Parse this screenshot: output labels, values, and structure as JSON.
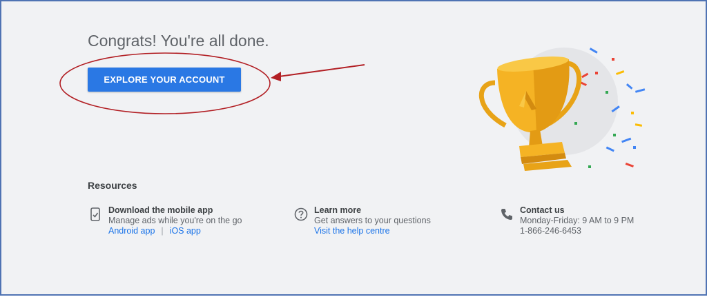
{
  "main": {
    "title": "Congrats! You're all done.",
    "explore_button_label": "EXPLORE YOUR ACCOUNT"
  },
  "resources": {
    "heading": "Resources",
    "items": [
      {
        "icon": "phone-checklist-icon",
        "title": "Download the mobile app",
        "description": "Manage ads while you're on the go",
        "links": [
          "Android app",
          "iOS app"
        ],
        "separator": "|"
      },
      {
        "icon": "help-circle-icon",
        "title": "Learn more",
        "description": "Get answers to your questions",
        "links": [
          "Visit the help centre"
        ]
      },
      {
        "icon": "phone-icon",
        "title": "Contact us",
        "description": "Monday-Friday: 9 AM to 9 PM",
        "phone": "1-866-246-6453"
      }
    ]
  },
  "illustration": {
    "name": "trophy-with-confetti",
    "trophy_color": "#f5b324"
  },
  "annotation": {
    "highlight_color": "#b21f24"
  },
  "colors": {
    "accent": "#2a78e4",
    "link": "#1a73e8",
    "background": "#f1f2f4",
    "border": "#4f73b3"
  }
}
